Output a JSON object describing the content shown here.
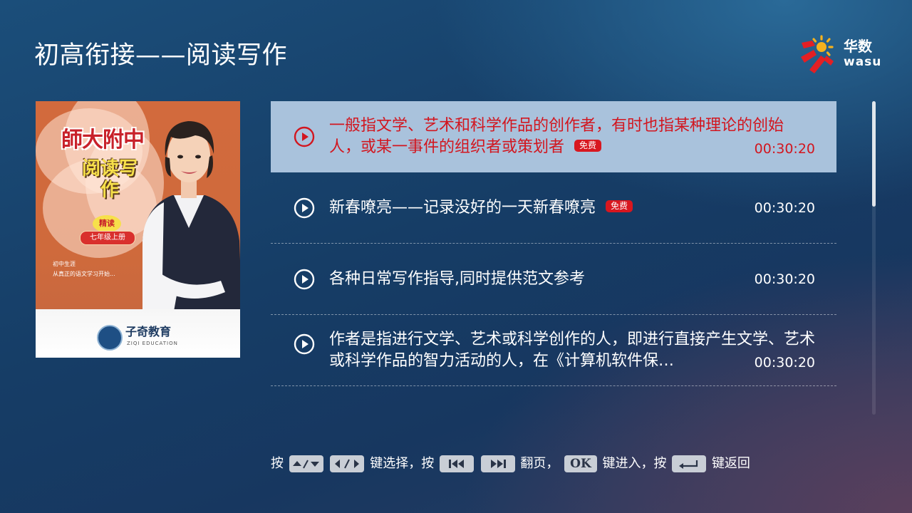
{
  "page": {
    "title": "初高衔接——阅读写作"
  },
  "logo": {
    "name_cn": "华数",
    "name_en": "wasu"
  },
  "cover": {
    "title_top": "師大附中",
    "title_main": "阅读写作",
    "seal_top": "精读",
    "grade": "七年级上册",
    "note_lines": [
      "初中生涯",
      "从真正的语文学习开始..."
    ],
    "brand_name": "子奇教育",
    "brand_sub": "ZIQI EDUCATION"
  },
  "episodes": [
    {
      "title": "一般指文学、艺术和科学作品的创作者，有时也指某种理论的创始人，或某一事件的组织者或策划者",
      "badge": "免费",
      "duration": "00:30:20",
      "focused": true
    },
    {
      "title": "新春嘹亮——记录没好的一天新春嘹亮",
      "badge": "免费",
      "duration": "00:30:20",
      "focused": false
    },
    {
      "title": "各种日常写作指导,同时提供范文参考",
      "badge": "",
      "duration": "00:30:20",
      "focused": false
    },
    {
      "title": "作者是指进行文学、艺术或科学创作的人，即进行直接产生文学、艺术或科学作品的智力活动的人，在《计算机软件保…",
      "badge": "",
      "duration": "00:30:20",
      "focused": false
    }
  ],
  "scroll": {
    "position": 0.0
  },
  "hint": {
    "press": "按",
    "select": "键选择，按",
    "page": "翻页，",
    "ok_key": "OK",
    "enter": "键进入，按",
    "back": "键返回"
  },
  "colors": {
    "accent_red": "#d2161f",
    "focus_bg": "#a9c2dc",
    "badge_red": "#d8171f"
  }
}
